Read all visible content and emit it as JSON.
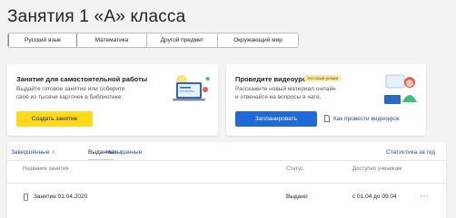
{
  "page": {
    "title": "Занятия 1 «А» класса"
  },
  "subjects": {
    "tabs": [
      {
        "label": "Русский язык",
        "active": true
      },
      {
        "label": "Математика",
        "active": false
      },
      {
        "label": "Другой предмет",
        "active": false
      },
      {
        "label": "Окружающий мир",
        "active": false
      }
    ]
  },
  "self_work_card": {
    "title": "Занятие для самостоятельной работы",
    "desc_line1": "Выдайте готовое занятие или соберите",
    "desc_line2": "своё из тысячи карточек в библиотеке.",
    "button": "Создать занятие"
  },
  "video_card": {
    "title": "Проведите видеоурок",
    "badge": "тестовый режим",
    "desc_line1": "Расскажите новый материал онлайн",
    "desc_line2": "и отвечайте на вопросы в чате.",
    "button": "Запланировать",
    "howto_link": "Как провести видеоурок"
  },
  "lessons": {
    "tabs": [
      {
        "label": "Завершённые",
        "count": "6"
      },
      {
        "label": "Выданные",
        "count": "1"
      },
      {
        "label": "Невыданные",
        "count": ""
      }
    ],
    "stats_link": "Статистика за год",
    "columns": {
      "name": "Название занятия",
      "status": "Статус",
      "available": "Доступно ученикам"
    },
    "rows": [
      {
        "name": "Занятие 01.04.2020",
        "status": "Выдано",
        "available": "с 01.04 до 09.04",
        "menu": "···"
      }
    ]
  },
  "colors": {
    "accent_yellow": "#ffd91a",
    "accent_blue": "#1f6ad6",
    "link": "#1f4ea8"
  }
}
